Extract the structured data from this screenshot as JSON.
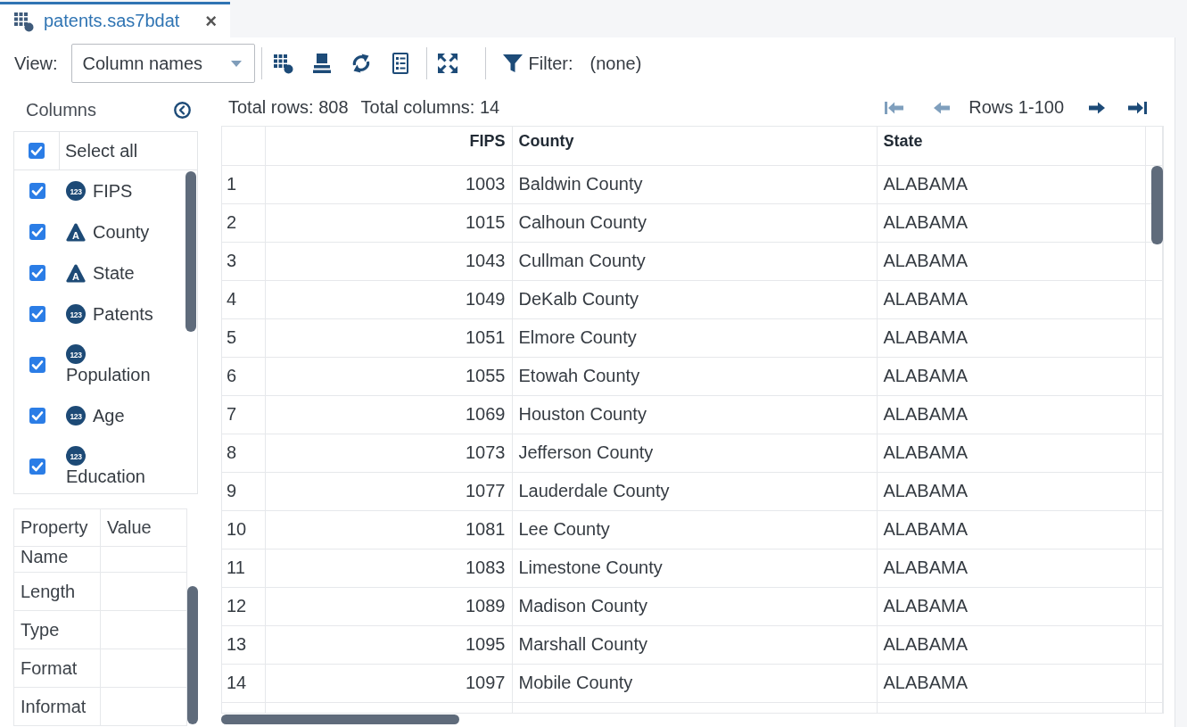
{
  "tab": {
    "label": "patents.sas7bdat",
    "close": "×",
    "selected": true
  },
  "toolbar": {
    "view_label": "View:",
    "view_select": {
      "value": "Column names"
    },
    "filter_label": "Filter:",
    "filter_value": "(none)"
  },
  "columns_panel": {
    "title": "Columns",
    "select_all": {
      "label": "Select all",
      "checked": true
    },
    "items": [
      {
        "label": "FIPS",
        "kind": "numeric",
        "icon_text": "123",
        "checked": true
      },
      {
        "label": "County",
        "kind": "character",
        "icon_text": "A",
        "checked": true
      },
      {
        "label": "State",
        "kind": "character",
        "icon_text": "A",
        "checked": true
      },
      {
        "label": "Patents",
        "kind": "numeric",
        "icon_text": "123",
        "checked": true
      },
      {
        "label": "Population",
        "kind": "numeric",
        "icon_text": "123",
        "checked": true
      },
      {
        "label": "Age",
        "kind": "numeric",
        "icon_text": "123",
        "checked": true
      },
      {
        "label": "Education",
        "kind": "numeric",
        "icon_text": "123",
        "checked": true
      }
    ]
  },
  "properties": {
    "columns": [
      "Property",
      "Value"
    ],
    "rows": [
      "Name",
      "Length",
      "Type",
      "Format",
      "Informat"
    ]
  },
  "summary": {
    "total_rows": "Total rows: 808",
    "total_columns": "Total columns: 14"
  },
  "pager": {
    "first": {
      "disabled": true
    },
    "previous": {
      "disabled": true
    },
    "range": "Rows 1-100",
    "next": {
      "disabled": false
    },
    "last": {
      "disabled": false
    }
  },
  "table": {
    "columns": [
      {
        "label": "FIPS",
        "kind": "numeric"
      },
      {
        "label": "County",
        "kind": "character"
      },
      {
        "label": "State",
        "kind": "character"
      }
    ],
    "rows": [
      {
        "number": "1",
        "cells": [
          "1003",
          "Baldwin County",
          "ALABAMA"
        ]
      },
      {
        "number": "2",
        "cells": [
          "1015",
          "Calhoun County",
          "ALABAMA"
        ]
      },
      {
        "number": "3",
        "cells": [
          "1043",
          "Cullman County",
          "ALABAMA"
        ]
      },
      {
        "number": "4",
        "cells": [
          "1049",
          "DeKalb County",
          "ALABAMA"
        ]
      },
      {
        "number": "5",
        "cells": [
          "1051",
          "Elmore County",
          "ALABAMA"
        ]
      },
      {
        "number": "6",
        "cells": [
          "1055",
          "Etowah County",
          "ALABAMA"
        ]
      },
      {
        "number": "7",
        "cells": [
          "1069",
          "Houston County",
          "ALABAMA"
        ]
      },
      {
        "number": "8",
        "cells": [
          "1073",
          "Jefferson County",
          "ALABAMA"
        ]
      },
      {
        "number": "9",
        "cells": [
          "1077",
          "Lauderdale County",
          "ALABAMA"
        ]
      },
      {
        "number": "10",
        "cells": [
          "1081",
          "Lee County",
          "ALABAMA"
        ]
      },
      {
        "number": "11",
        "cells": [
          "1083",
          "Limestone County",
          "ALABAMA"
        ]
      },
      {
        "number": "12",
        "cells": [
          "1089",
          "Madison County",
          "ALABAMA"
        ]
      },
      {
        "number": "13",
        "cells": [
          "1095",
          "Marshall County",
          "ALABAMA"
        ]
      },
      {
        "number": "14",
        "cells": [
          "1097",
          "Mobile County",
          "ALABAMA"
        ]
      }
    ]
  }
}
